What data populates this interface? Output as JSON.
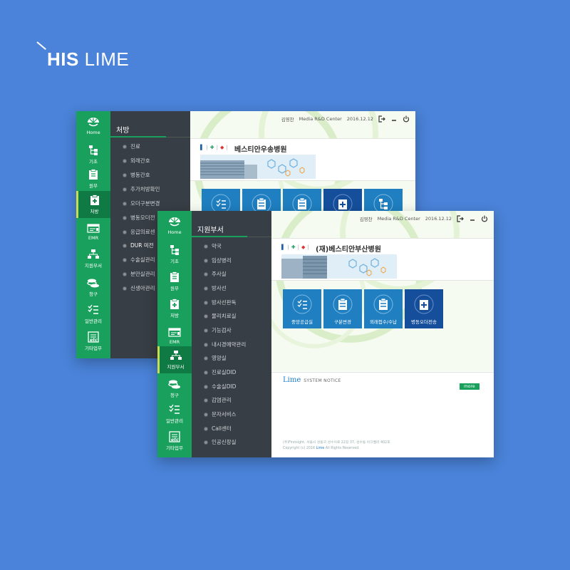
{
  "brand": {
    "bold": "HIS",
    "light": "LIME"
  },
  "colors": {
    "background": "#4a83d9",
    "sidebar": "#1aa05d",
    "menu": "#383e45",
    "tile": "#1f7fc1",
    "tile_dark": "#154f9c"
  },
  "sidebar_icons": [
    "lime-home-icon",
    "hierarchy-icon",
    "clipboard-icon",
    "prescription-icon",
    "emr-card-icon",
    "org-chart-icon",
    "coins-icon",
    "checklist-icon",
    "etc-doc-icon"
  ],
  "back_window": {
    "sidebar": [
      "Home",
      "기초",
      "원무",
      "처방",
      "EMR",
      "지원부서",
      "청구",
      "일반관리",
      "기타업무"
    ],
    "menu_title": "처방",
    "menu_items": [
      "진료",
      "외래간호",
      "병동간호",
      "추가처방확인",
      "오더구분변경",
      "병동오더전",
      "응급의료센",
      "DUR 미전",
      "수술실관리",
      "분만실관리",
      "신생아관리"
    ],
    "topbar": {
      "user": "김영찬",
      "dept": "Media R&D Center",
      "date": "2016.12.12"
    },
    "hospital": "베스티안우송병원"
  },
  "front_window": {
    "sidebar": [
      "Home",
      "기초",
      "원무",
      "처방",
      "EMR",
      "지원부서",
      "청구",
      "일반관리",
      "기타업무"
    ],
    "menu_title": "지원부서",
    "menu_items": [
      "약국",
      "임상병리",
      "주사실",
      "방사선",
      "방사선판독",
      "물리치료실",
      "기능검사",
      "내시경예약관리",
      "영양실",
      "진료실DID",
      "수술실DID",
      "감염관리",
      "문자서비스",
      "Call센터",
      "인공신장실"
    ],
    "topbar": {
      "user": "김영찬",
      "dept": "Media R&D Center",
      "date": "2016.12.12"
    },
    "hospital": "(재)베스티안부산병원",
    "tiles": [
      {
        "label": "중앙공급실",
        "icon": "checklist-icon"
      },
      {
        "label": "구분변경",
        "icon": "clipboard-icon"
      },
      {
        "label": "외래접수/수납",
        "icon": "clipboard-icon"
      },
      {
        "label": "병동오더전송",
        "icon": "prescription-icon"
      }
    ],
    "notice": {
      "logo": "Lime",
      "title": "SYSTEM NOTICE",
      "more": "more"
    },
    "footer": {
      "line1": "(주)Firstsight, 서울시 성동구 성수이로 22길 37, 성수동 아크밸리 402호",
      "line2_prefix": "Copyright (c) 2016",
      "line2_brand": "Lime",
      "line2_suffix": "All Rights Reserved."
    }
  }
}
